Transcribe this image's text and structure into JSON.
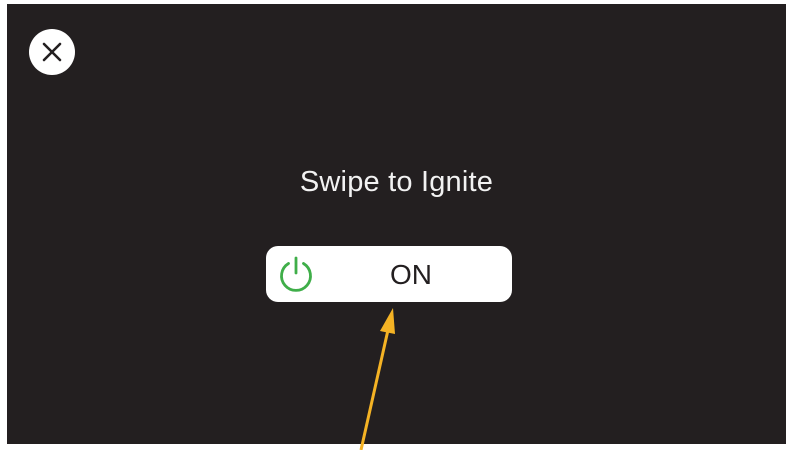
{
  "screen": {
    "background": "#231f20"
  },
  "close_button": {
    "icon": "close-icon"
  },
  "prompt": {
    "title": "Swipe to Ignite"
  },
  "slider": {
    "label": "ON",
    "handle_icon": "power-icon",
    "handle_color": "#3fae49",
    "background": "#ffffff"
  },
  "annotation": {
    "type": "arrow",
    "color": "#f5b324"
  }
}
